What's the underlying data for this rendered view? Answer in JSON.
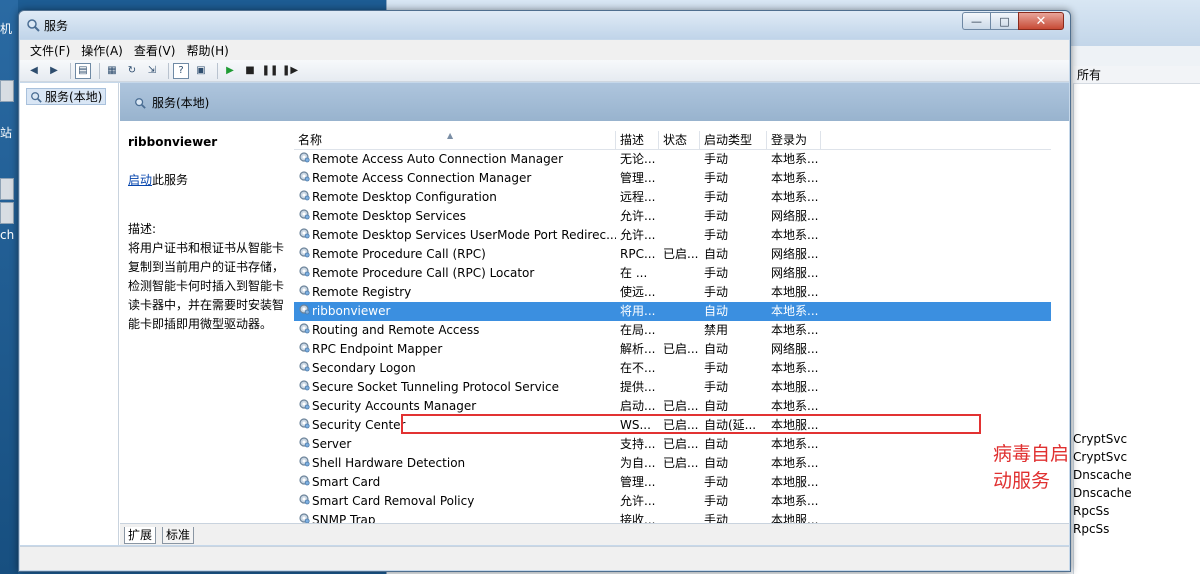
{
  "window": {
    "title": "服务",
    "controls": {
      "minimize": "—",
      "maximize": "□",
      "close": "✕"
    }
  },
  "menu": [
    "文件(F)",
    "操作(A)",
    "查看(V)",
    "帮助(H)"
  ],
  "tree": {
    "root": "服务(本地)"
  },
  "pane": {
    "header": "服务(本地)"
  },
  "description_panel": {
    "service_name": "ribbonviewer",
    "action_link": "启动",
    "action_suffix": "此服务",
    "desc_label": "描述:",
    "desc_text": "将用户证书和根证书从智能卡复制到当前用户的证书存储，检测智能卡何时插入到智能卡读卡器中，并在需要时安装智能卡即插即用微型驱动器。"
  },
  "columns": {
    "name": "名称",
    "desc": "描述",
    "status": "状态",
    "startup": "启动类型",
    "logon": "登录为"
  },
  "rows": [
    {
      "name": "Remote Access Auto Connection Manager",
      "desc": "无论...",
      "status": "",
      "startup": "手动",
      "logon": "本地系..."
    },
    {
      "name": "Remote Access Connection Manager",
      "desc": "管理...",
      "status": "",
      "startup": "手动",
      "logon": "本地系..."
    },
    {
      "name": "Remote Desktop Configuration",
      "desc": "远程...",
      "status": "",
      "startup": "手动",
      "logon": "本地系..."
    },
    {
      "name": "Remote Desktop Services",
      "desc": "允许...",
      "status": "",
      "startup": "手动",
      "logon": "网络服..."
    },
    {
      "name": "Remote Desktop Services UserMode Port Redirec...",
      "desc": "允许...",
      "status": "",
      "startup": "手动",
      "logon": "本地系..."
    },
    {
      "name": "Remote Procedure Call (RPC)",
      "desc": "RPC...",
      "status": "已启...",
      "startup": "自动",
      "logon": "网络服..."
    },
    {
      "name": "Remote Procedure Call (RPC) Locator",
      "desc": "在 ...",
      "status": "",
      "startup": "手动",
      "logon": "网络服..."
    },
    {
      "name": "Remote Registry",
      "desc": "使远...",
      "status": "",
      "startup": "手动",
      "logon": "本地服..."
    },
    {
      "name": "ribbonviewer",
      "desc": "将用...",
      "status": "",
      "startup": "自动",
      "logon": "本地系...",
      "selected": true
    },
    {
      "name": "Routing and Remote Access",
      "desc": "在局...",
      "status": "",
      "startup": "禁用",
      "logon": "本地系..."
    },
    {
      "name": "RPC Endpoint Mapper",
      "desc": "解析...",
      "status": "已启...",
      "startup": "自动",
      "logon": "网络服..."
    },
    {
      "name": "Secondary Logon",
      "desc": "在不...",
      "status": "",
      "startup": "手动",
      "logon": "本地系..."
    },
    {
      "name": "Secure Socket Tunneling Protocol Service",
      "desc": "提供...",
      "status": "",
      "startup": "手动",
      "logon": "本地服..."
    },
    {
      "name": "Security Accounts Manager",
      "desc": "启动...",
      "status": "已启...",
      "startup": "自动",
      "logon": "本地系..."
    },
    {
      "name": "Security Center",
      "desc": "WS...",
      "status": "已启...",
      "startup": "自动(延...",
      "logon": "本地服..."
    },
    {
      "name": "Server",
      "desc": "支持...",
      "status": "已启...",
      "startup": "自动",
      "logon": "本地系..."
    },
    {
      "name": "Shell Hardware Detection",
      "desc": "为自...",
      "status": "已启...",
      "startup": "自动",
      "logon": "本地系..."
    },
    {
      "name": "Smart Card",
      "desc": "管理...",
      "status": "",
      "startup": "手动",
      "logon": "本地服..."
    },
    {
      "name": "Smart Card Removal Policy",
      "desc": "允许...",
      "status": "",
      "startup": "手动",
      "logon": "本地系..."
    },
    {
      "name": "SNMP Trap",
      "desc": "接收...",
      "status": "",
      "startup": "手动",
      "logon": "本地服..."
    }
  ],
  "annotation": "病毒自启动服务",
  "tabs": [
    "扩展",
    "标准"
  ],
  "background": {
    "desktop_labels": [
      "机",
      "站",
      "ch"
    ],
    "column_header": "所有",
    "processes": [
      "CryptSvc",
      "CryptSvc",
      "Dnscache",
      "Dnscache",
      "RpcSs",
      "RpcSs"
    ]
  },
  "colors": {
    "selection": "#3b8fe0",
    "annotation": "#e03030",
    "link": "#0645ad"
  }
}
